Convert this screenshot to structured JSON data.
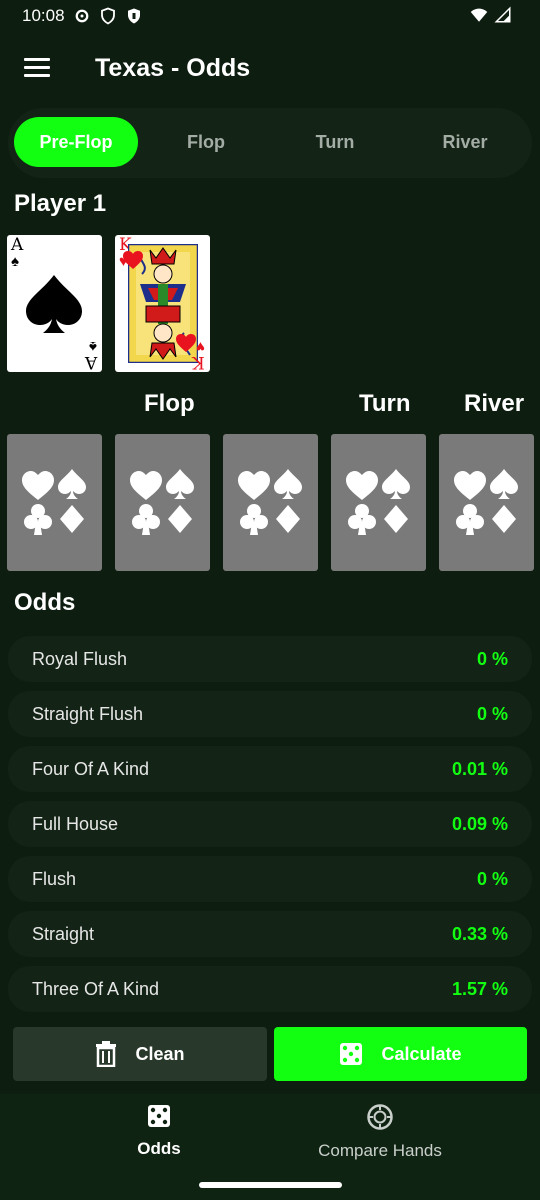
{
  "status": {
    "time": "10:08"
  },
  "app_bar": {
    "title": "Texas - Odds"
  },
  "tabs": [
    {
      "label": "Pre-Flop",
      "active": true
    },
    {
      "label": "Flop",
      "active": false
    },
    {
      "label": "Turn",
      "active": false
    },
    {
      "label": "River",
      "active": false
    }
  ],
  "player": {
    "title": "Player 1",
    "cards": [
      {
        "rank": "A",
        "suit": "♠",
        "suit_name": "spades"
      },
      {
        "rank": "K",
        "suit": "♥",
        "suit_name": "hearts"
      }
    ]
  },
  "board": {
    "flop_label": "Flop",
    "turn_label": "Turn",
    "river_label": "River",
    "empty_card_icon": "card-suits-icon"
  },
  "odds": {
    "title": "Odds",
    "rows": [
      {
        "name": "Royal Flush",
        "value": "0 %"
      },
      {
        "name": "Straight Flush",
        "value": "0 %"
      },
      {
        "name": "Four Of A Kind",
        "value": "0.01 %"
      },
      {
        "name": "Full House",
        "value": "0.09 %"
      },
      {
        "name": "Flush",
        "value": "0 %"
      },
      {
        "name": "Straight",
        "value": "0.33 %"
      },
      {
        "name": "Three Of A Kind",
        "value": "1.57 %"
      }
    ]
  },
  "actions": {
    "clean_label": "Clean",
    "calculate_label": "Calculate"
  },
  "bottom_nav": {
    "items": [
      {
        "label": "Odds",
        "icon": "dice-icon",
        "active": true
      },
      {
        "label": "Compare Hands",
        "icon": "poker-chip-icon",
        "active": false
      }
    ]
  },
  "colors": {
    "background": "#0d1d0f",
    "accent": "#12ff12",
    "surface": "#132416",
    "empty_card": "#7a7a7a",
    "heart": "#e8131e"
  }
}
